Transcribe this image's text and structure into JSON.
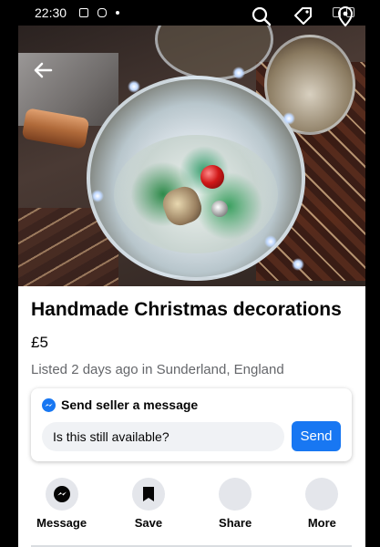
{
  "status_bar": {
    "time": "22:30"
  },
  "listing": {
    "title": "Handmade Christmas decorations",
    "price": "£5",
    "listed": "Listed 2 days ago in Sunderland, England"
  },
  "message_card": {
    "heading": "Send seller a message",
    "input_value": "Is this still available?",
    "send_label": "Send"
  },
  "actions": [
    {
      "label": "Message",
      "icon": "messenger-icon"
    },
    {
      "label": "Save",
      "icon": "bookmark-icon"
    },
    {
      "label": "Share",
      "icon": "share-icon"
    },
    {
      "label": "More",
      "icon": "more-icon"
    }
  ],
  "photo_carousel": {
    "slide_count": 4,
    "active_index": 0
  },
  "colors": {
    "accent": "#1877f2",
    "text": "#050505",
    "secondary_text": "#65676b",
    "button_bg": "#e4e6eb"
  }
}
